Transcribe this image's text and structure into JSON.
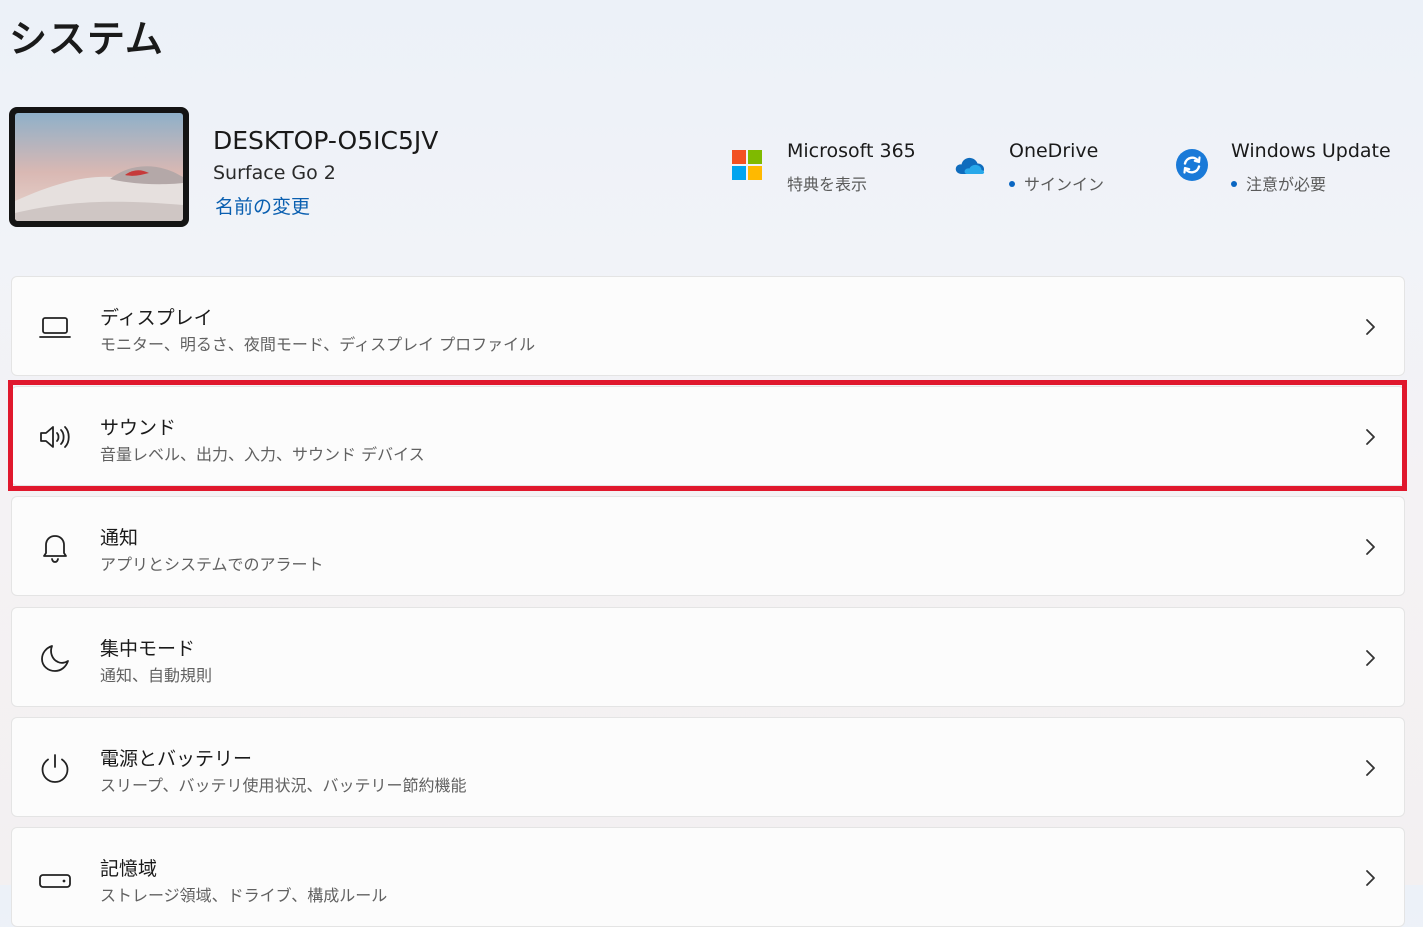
{
  "page": {
    "title": "システム"
  },
  "device": {
    "name": "DESKTOP-O5IC5JV",
    "model": "Surface Go 2",
    "rename_link": "名前の変更",
    "thumbnail_icon": "desktop-wallpaper-thumbnail"
  },
  "quick_links": [
    {
      "title": "Microsoft 365",
      "subtitle": "特典を表示",
      "icon": "microsoft-logo-icon",
      "status_dot": false
    },
    {
      "title": "OneDrive",
      "subtitle": "サインイン",
      "icon": "onedrive-cloud-icon",
      "status_dot": true
    },
    {
      "title": "Windows Update",
      "subtitle": "注意が必要",
      "icon": "windows-update-icon",
      "status_dot": true
    }
  ],
  "settings": [
    {
      "title": "ディスプレイ",
      "subtitle": "モニター、明るさ、夜間モード、ディスプレイ プロファイル",
      "icon": "display-laptop-icon"
    },
    {
      "title": "サウンド",
      "subtitle": "音量レベル、出力、入力、サウンド デバイス",
      "icon": "speaker-icon",
      "highlighted": true
    },
    {
      "title": "通知",
      "subtitle": "アプリとシステムでのアラート",
      "icon": "bell-icon"
    },
    {
      "title": "集中モード",
      "subtitle": "通知、自動規則",
      "icon": "moon-icon"
    },
    {
      "title": "電源とバッテリー",
      "subtitle": "スリープ、バッテリ使用状況、バッテリー節約機能",
      "icon": "power-icon"
    },
    {
      "title": "記憶域",
      "subtitle": "ストレージ領域、ドライブ、構成ルール",
      "icon": "storage-drive-icon"
    }
  ],
  "colors": {
    "accent": "#0a5fb0",
    "highlight": "#e0182d",
    "ms_red": "#f25022",
    "ms_green": "#7fba00",
    "ms_blue": "#00a4ef",
    "ms_yellow": "#ffb900"
  }
}
